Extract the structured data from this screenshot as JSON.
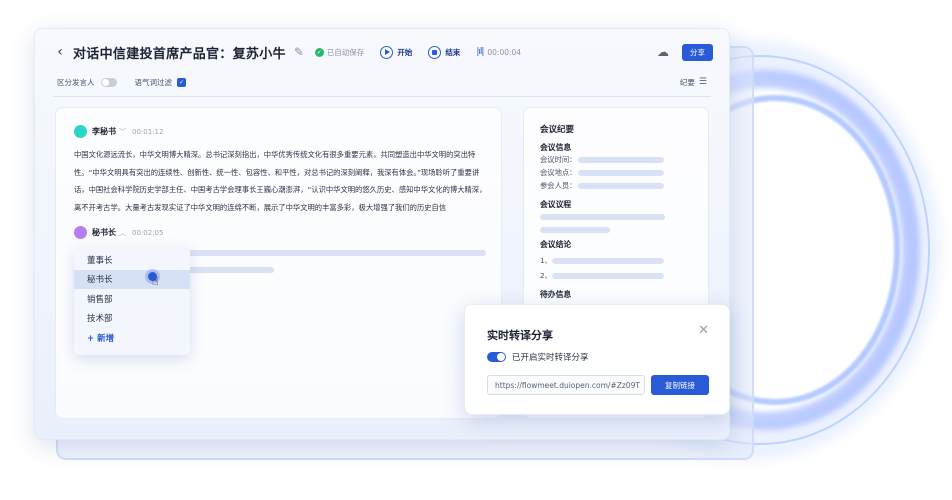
{
  "header": {
    "title": "对话中信建投首席产品官：复苏小牛",
    "saved_status": "已自动保存",
    "start_label": "开始",
    "stop_label": "结束",
    "timer": "00:00:04",
    "share_label": "分享"
  },
  "toolbar": {
    "distinguish_speaker_label": "区分发言人",
    "filler_filter_label": "语气词过滤",
    "minutes_label": "纪要"
  },
  "transcript": {
    "speaker1": {
      "name": "李秘书",
      "time": "00:01:12",
      "avatar_color": "#2bd4c4"
    },
    "paragraph": "中国文化源远流长，中华文明博大精深。总书记深刻指出，中华优秀传统文化有很多重要元素，共同塑造出中华文明的突出特性。“中华文明具有突出的连续性、创新性、统一性、包容性、和平性，对总书记的深刻阐释，我深有体会。”现场聆听了重要讲话，中国社会科学院历史学部主任、中国考古学会理事长王巍心潮澎湃，“认识中华文明的悠久历史、感知中华文化的博大精深，离不开考古学。大量考古发现实证了中华文明的连绵不断，展示了中华文明的丰富多彩，极大增强了我们的历史自信",
    "speaker2": {
      "name": "秘书长",
      "time": "00:02:05",
      "avatar_color": "#b67ef0"
    }
  },
  "dropdown": {
    "items": [
      "董事长",
      "秘书长",
      "销售部",
      "技术部"
    ],
    "selected_index": 1,
    "add_label": "+ 新增"
  },
  "minutes": {
    "title": "会议纪要",
    "info_title": "会议信息",
    "time_label": "会议时间：",
    "place_label": "会议地点：",
    "attendee_label": "参会人员：",
    "agenda_title": "会议议程",
    "conclusion_title": "会议结论",
    "conclusion_1": "1、",
    "conclusion_2": "2、",
    "todo_title": "待办信息"
  },
  "share_dialog": {
    "title": "实时转译分享",
    "toggle_label": "已开启实时转译分享",
    "toggle_on": true,
    "link": "https://flowmeet.duiopen.com/#Zz09T",
    "copy_label": "复制链接"
  },
  "colors": {
    "accent": "#2a5bd7",
    "saved": "#28b86b"
  }
}
